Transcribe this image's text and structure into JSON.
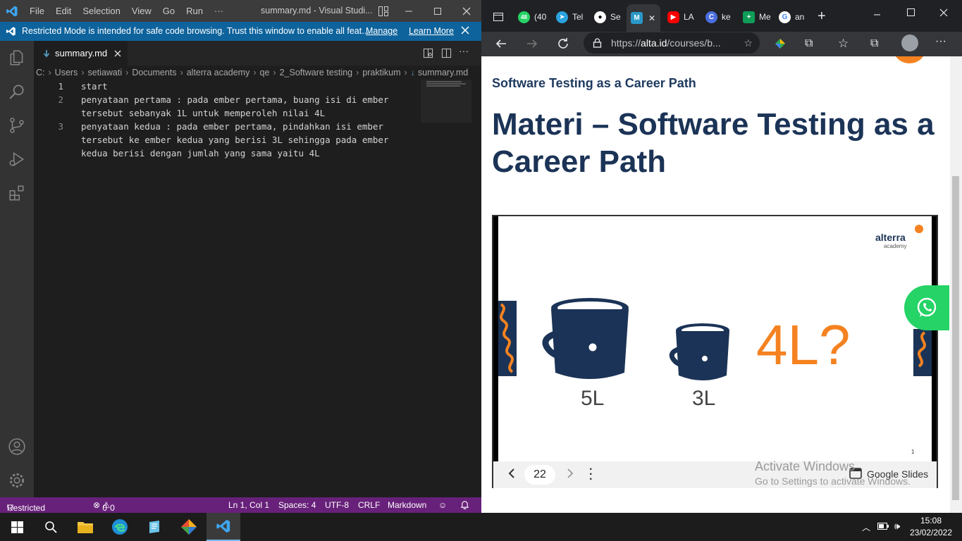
{
  "vscode": {
    "menu": [
      "File",
      "Edit",
      "Selection",
      "View",
      "Go",
      "Run",
      "···"
    ],
    "window_title": "summary.md - Visual Studi...",
    "banner": {
      "text": "Restricted Mode is intended for safe code browsing. Trust this window to enable all feat...",
      "manage": "Manage",
      "learn_more": "Learn More"
    },
    "tab_name": "summary.md",
    "breadcrumb": [
      "C:",
      "Users",
      "setiawati",
      "Documents",
      "alterra academy",
      "qe",
      "2_Software testing",
      "praktikum",
      "summary.md"
    ],
    "line_numbers": [
      "1",
      "2",
      "3"
    ],
    "lines": [
      "start",
      "penyataan pertama : pada ember pertama, buang isi di ember\ntersebut sebanyak 1L untuk memperoleh nilai 4L",
      "penyataan kedua : pada ember pertama, pindahkan isi ember\ntersebut ke ember kedua yang berisi 3L sehingga pada ember\nkedua berisi dengan jumlah yang sama yaitu 4L"
    ],
    "status": {
      "mode": "Restricted Mode",
      "errors": "0",
      "warnings": "0",
      "position": "Ln 1, Col 1",
      "spaces": "Spaces: 4",
      "encoding": "UTF-8",
      "eol": "CRLF",
      "language": "Markdown"
    }
  },
  "browser": {
    "tabs": [
      {
        "icon": "whatsapp-icon",
        "badge": "48",
        "label": "(40"
      },
      {
        "icon": "telegram-icon",
        "label": "Tel"
      },
      {
        "icon": "github-icon",
        "label": "Se"
      },
      {
        "icon": "medium-icon",
        "label": ""
      },
      {
        "icon": "youtube-icon",
        "label": "LA"
      },
      {
        "icon": "chrome-icon",
        "label": "ke"
      },
      {
        "icon": "sheets-icon",
        "label": "Me"
      },
      {
        "icon": "google-icon",
        "label": "an"
      }
    ],
    "url_prefix": "https://",
    "url_domain": "alta.id",
    "url_rest": "/courses/b...",
    "subheading": "Software Testing as a Career Path",
    "heading": "Materi – Software Testing as a Career Path",
    "slide": {
      "brand": "alterra",
      "brand_sub": "academy",
      "bucket_big": "5L",
      "bucket_small": "3L",
      "question": "4L?",
      "page_mark": "1",
      "page_number": "22",
      "provider": "Google Slides"
    },
    "watermark": {
      "line1": "Activate Windows",
      "line2": "Go to Settings to activate Windows."
    }
  },
  "taskbar": {
    "time": "15:08",
    "date": "23/02/2022"
  }
}
